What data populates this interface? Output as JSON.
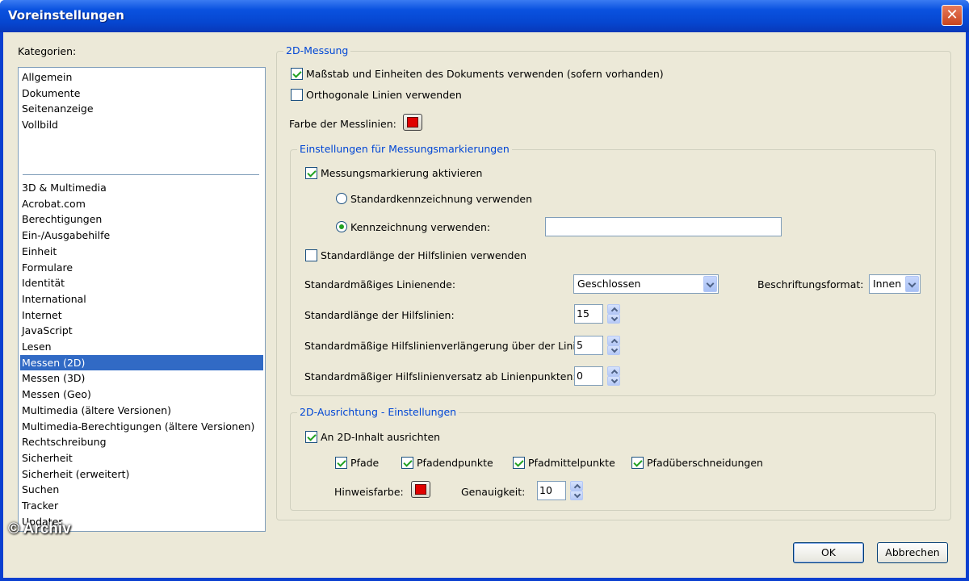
{
  "window": {
    "title": "Voreinstellungen",
    "close_glyph": "✕"
  },
  "sidebar": {
    "label": "Kategorien:",
    "group1": [
      "Allgemein",
      "Dokumente",
      "Seitenanzeige",
      "Vollbild"
    ],
    "group2": [
      "3D & Multimedia",
      "Acrobat.com",
      "Berechtigungen",
      "Ein-/Ausgabehilfe",
      "Einheit",
      "Formulare",
      "Identität",
      "International",
      "Internet",
      "JavaScript",
      "Lesen",
      "Messen (2D)",
      "Messen (3D)",
      "Messen (Geo)",
      "Multimedia (ältere Versionen)",
      "Multimedia-Berechtigungen (ältere Versionen)",
      "Rechtschreibung",
      "Sicherheit",
      "Sicherheit (erweitert)",
      "Suchen",
      "Tracker",
      "Updater"
    ],
    "selected": "Messen (2D)"
  },
  "messung": {
    "legend": "2D-Messung",
    "scale_label": "Maßstab und Einheiten des Dokuments verwenden (sofern vorhanden)",
    "scale_checked": true,
    "ortho_label": "Orthogonale Linien verwenden",
    "ortho_checked": false,
    "color_label": "Farbe der Messlinien:",
    "color": "#e00000"
  },
  "markierung": {
    "legend": "Einstellungen für Messungsmarkierungen",
    "enable_label": "Messungsmarkierung aktivieren",
    "enable_checked": true,
    "radio_standard_label": "Standardkennzeichnung verwenden",
    "radio_custom_label": "Kennzeichnung verwenden:",
    "selected_radio": "custom",
    "custom_value": "",
    "guide_len_label": "Standardlänge der Hilfslinien verwenden",
    "guide_len_checked": false,
    "line_end_label": "Standardmäßiges Linienende:",
    "line_end_value": "Geschlossen",
    "caption_label": "Beschriftungsformat:",
    "caption_value": "Innen",
    "guide_length_label": "Standardlänge der Hilfslinien:",
    "guide_length_value": "15",
    "extension_label": "Standardmäßige Hilfslinienverlängerung über der Linie:",
    "extension_value": "5",
    "offset_label": "Standardmäßiger Hilfslinienversatz ab Linienpunkten:",
    "offset_value": "0"
  },
  "ausrichtung": {
    "legend": "2D-Ausrichtung - Einstellungen",
    "snap_label": "An 2D-Inhalt ausrichten",
    "snap_checked": true,
    "paths_label": "Pfade",
    "endpoints_label": "Pfadendpunkte",
    "midpoints_label": "Pfadmittelpunkte",
    "intersections_label": "Pfadüberschneidungen",
    "hint_color_label": "Hinweisfarbe:",
    "hint_color": "#e00000",
    "precision_label": "Genauigkeit:",
    "precision_value": "10"
  },
  "buttons": {
    "ok": "OK",
    "cancel": "Abbrechen"
  },
  "watermark": "© Archiv"
}
